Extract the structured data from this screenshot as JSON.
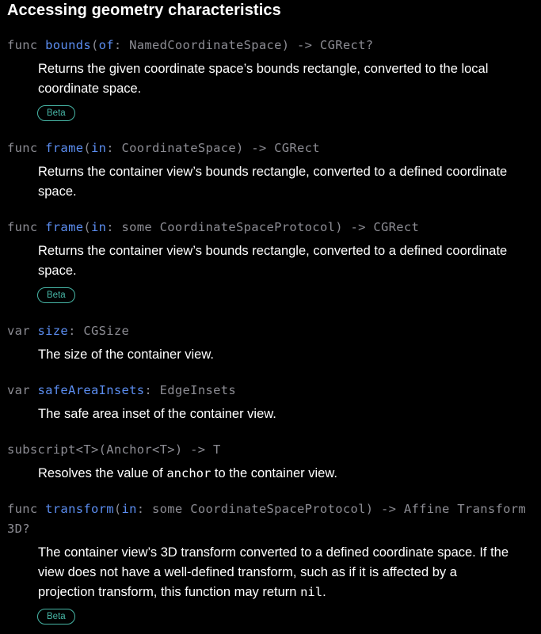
{
  "section": {
    "title": "Accessing geometry characteristics"
  },
  "entries": [
    {
      "sig": {
        "keyword": "func ",
        "name": "bounds",
        "open": "(",
        "label": "of",
        "rest": ": NamedCoordinateSpace) -> CGRect?"
      },
      "desc": "Returns the given coordinate space’s bounds rectangle, converted to the local coordinate space.",
      "badge": "Beta"
    },
    {
      "sig": {
        "keyword": "func ",
        "name": "frame",
        "open": "(",
        "label": "in",
        "rest": ": CoordinateSpace) -> CGRect"
      },
      "desc": "Returns the container view’s bounds rectangle, converted to a defined coordinate space."
    },
    {
      "sig": {
        "keyword": "func ",
        "name": "frame",
        "open": "(",
        "label": "in",
        "rest": ": some CoordinateSpaceProtocol) -> CGRect"
      },
      "desc": "Returns the container view’s bounds rectangle, converted to a defined coordinate space.",
      "badge": "Beta"
    },
    {
      "sig": {
        "keyword": "var ",
        "name": "size",
        "rest": ": CGSize"
      },
      "desc": "The size of the container view."
    },
    {
      "sig": {
        "keyword": "var ",
        "name": "safeAreaInsets",
        "rest": ": EdgeInsets"
      },
      "desc": "The safe area inset of the container view."
    },
    {
      "sig": {
        "plain": "subscript<T>(Anchor<T>) -> T"
      },
      "desc_pre": "Resolves the value of ",
      "desc_code": "anchor",
      "desc_post": " to the container view."
    },
    {
      "sig": {
        "keyword": "func ",
        "name": "transform",
        "open": "(",
        "label": "in",
        "rest": ": some CoordinateSpaceProtocol) -> Affine Transform3D?"
      },
      "desc_pre": "The container view’s 3D transform converted to a defined coordinate space. If the view does not have a well-defined transform, such as if it is affected by a projection transform, this function may return ",
      "desc_code": "nil",
      "desc_post": ".",
      "badge": "Beta"
    }
  ]
}
